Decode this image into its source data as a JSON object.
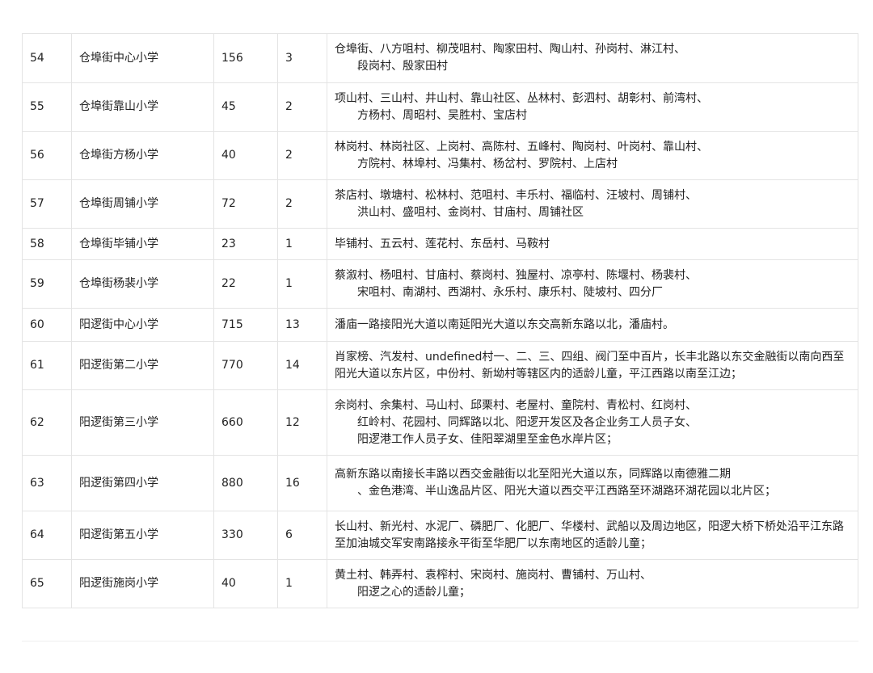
{
  "rows": [
    {
      "no": "54",
      "school": "仓埠街中心小学",
      "count": "156",
      "classes": "3",
      "area": "仓埠街、八方咀村、柳茂咀村、陶家田村、陶山村、孙岗村、淋江村、\n　　段岗村、殷家田村"
    },
    {
      "no": "55",
      "school": "仓埠街靠山小学",
      "count": "45",
      "classes": "2",
      "area": "项山村、三山村、井山村、靠山社区、丛林村、彭泗村、胡彰村、前湾村、\n　　方杨村、周昭村、吴胜村、宝店村"
    },
    {
      "no": "56",
      "school": "仓埠街方杨小学",
      "count": "40",
      "classes": "2",
      "area": "林岗村、林岗社区、上岗村、高陈村、五峰村、陶岗村、叶岗村、靠山村、\n　　方院村、林埠村、冯集村、杨岔村、罗院村、上店村"
    },
    {
      "no": "57",
      "school": "仓埠街周铺小学",
      "count": "72",
      "classes": "2",
      "area": "茶店村、墩塘村、松林村、范咀村、丰乐村、福临村、汪坡村、周铺村、\n　　洪山村、盛咀村、金岗村、甘庙村、周铺社区"
    },
    {
      "no": "58",
      "school": "仓埠街毕铺小学",
      "count": "23",
      "classes": "1",
      "area": "毕铺村、五云村、莲花村、东岳村、马鞍村"
    },
    {
      "no": "59",
      "school": "仓埠街杨裴小学",
      "count": "22",
      "classes": "1",
      "area": "蔡溆村、杨咀村、甘庙村、蔡岗村、独屋村、凉亭村、陈堰村、杨裴村、\n　　宋咀村、南湖村、西湖村、永乐村、康乐村、陡坡村、四分厂"
    },
    {
      "no": "60",
      "school": "阳逻街中心小学",
      "count": "715",
      "classes": "13",
      "area": "潘庙一路接阳光大道以南延阳光大道以东交高新东路以北，潘庙村。"
    },
    {
      "no": "61",
      "school": "阳逻街第二小学",
      "count": "770",
      "classes": "14",
      "area": "肖家榜、汽发村、undefined村一、二、三、四组、阀门至中百片，长丰北路以东交金融街以南向西至阳光大道以东片区，中份村、新坳村等辖区内的适龄儿童，平江西路以南至江边；"
    },
    {
      "no": "62",
      "school": "阳逻街第三小学",
      "count": "660",
      "classes": "12",
      "area": "余岗村、余集村、马山村、邱栗村、老屋村、童院村、青松村、红岗村、\n　　红岭村、花园村、同辉路以北、阳逻开发区及各企业务工人员子女、\n　　阳逻港工作人员子女、佳阳翠湖里至金色水岸片区；"
    },
    {
      "no": "63",
      "school": "阳逻街第四小学",
      "count": "880",
      "classes": "16",
      "area": "高新东路以南接长丰路以西交金融街以北至阳光大道以东，同辉路以南德雅二期\n　　、金色港湾、半山逸品片区、阳光大道以西交平江西路至环湖路环湖花园以北片区；"
    },
    {
      "no": "64",
      "school": "阳逻街第五小学",
      "count": "330",
      "classes": "6",
      "area": "长山村、新光村、水泥厂、磷肥厂、化肥厂、华楼村、武船以及周边地区，阳逻大桥下桥处沿平江东路至加油城交军安南路接永平街至华肥厂以东南地区的适龄儿童；"
    },
    {
      "no": "65",
      "school": "阳逻街施岗小学",
      "count": "40",
      "classes": "1",
      "area": "黄土村、韩弄村、袁榨村、宋岗村、施岗村、曹铺村、万山村、\n　　阳逻之心的适龄儿童；"
    }
  ]
}
